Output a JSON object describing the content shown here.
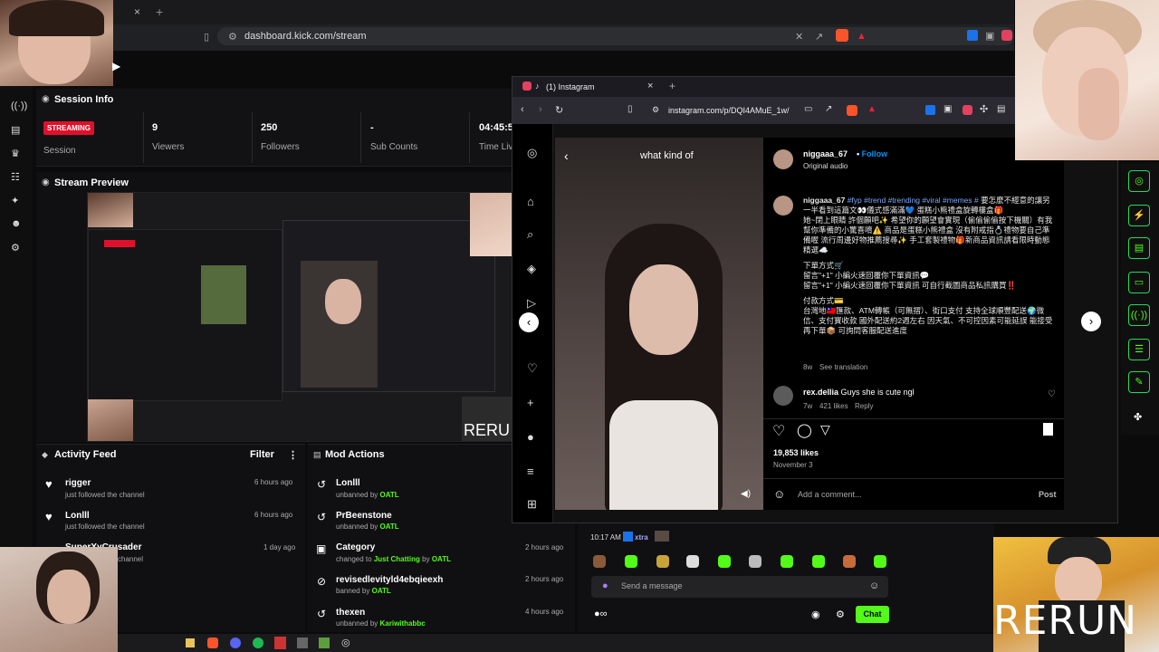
{
  "browser": {
    "url": "dashboard.kick.com/stream",
    "tab_close": "×",
    "tab_new": "+"
  },
  "session": {
    "title": "Session Info",
    "badge": "STREAMING",
    "session_label": "Session",
    "viewers_value": "9",
    "viewers_label": "Viewers",
    "followers_value": "250",
    "followers_label": "Followers",
    "subs_value": "-",
    "subs_label": "Sub Counts",
    "time_value": "04:45:5",
    "time_label": "Time Liv"
  },
  "preview": {
    "title": "Stream Preview",
    "rerun": "RERU"
  },
  "activity": {
    "title": "Activity Feed",
    "filter": "Filter",
    "more": "⋮",
    "items": [
      {
        "name": "rigger",
        "sub": "just followed the channel",
        "time": "6 hours ago"
      },
      {
        "name": "Lonlll",
        "sub": "just followed the channel",
        "time": "6 hours ago"
      },
      {
        "name": "SuperXyCrusader",
        "sub": "channel",
        "time": "1 day ago"
      }
    ]
  },
  "mod": {
    "title": "Mod Actions",
    "items": [
      {
        "name": "Lonlll",
        "pre": "unbanned by ",
        "by": "OATL",
        "mid": "",
        "extra": "",
        "time": ""
      },
      {
        "name": "PrBeenstone",
        "pre": "unbanned by ",
        "by": "OATL",
        "mid": "",
        "extra": "",
        "time": ""
      },
      {
        "name": "Category",
        "pre": "changed to ",
        "by": "Just Chatting",
        "mid": " by ",
        "extra": "OATL",
        "time": "2 hours ago"
      },
      {
        "name": "revisedlevityld4ebqieexh",
        "pre": "banned by ",
        "by": "OATL",
        "mid": "",
        "extra": "",
        "time": "2 hours ago"
      },
      {
        "name": "thexen",
        "pre": "unbanned by ",
        "by": "Kariwithabbc",
        "mid": "",
        "extra": "",
        "time": "4 hours ago"
      }
    ]
  },
  "instagram": {
    "tab_title": "(1) Instagram",
    "tab_close": "×",
    "tab_new": "+",
    "url": "instagram.com/p/DQI4AMuE_1w/",
    "video_caption": "what kind of",
    "author": "niggaaa_67",
    "follow": "Follow",
    "audio": "Original audio",
    "caption_author": "niggaaa_67",
    "caption_tags": "#fyp #trend #trending #viral #memes #",
    "caption_lines": [
      "要怎麼不經意的讓另一半看到這篇文👀儀式感滿滿💙 蛋糕小熊禮盒旋轉樓盒🎁",
      "她~閉上眼睛 許個願吧✨ 希望你的願望會實現（偷偷偷偷按下機關）有我幫你準備的小驚喜唷⚠️ 商品是蛋糕小熊禮盒 沒有附戒指💍禮物要自己準備喔 流行周邊好物推薦搜尋✨ 手工套製禮物🎁新商品資訊請看限時動態精選☁️",
      "",
      "下單方式🛒",
      "留言\"+1\" 小編火速回覆你下單資訊💬",
      "留言\"+1\" 小編火速回覆你下單資訊 可自行截圖商品私訊購買‼️",
      "",
      "付款方式💳",
      "台灣地🇹🇼匯款、ATM轉帳（可無摺）、街口支付 支持全球順豐配送🌍微信、支付寶收款 國外配送約2週左右 因天氣、不可控因素可能延誤 能接受再下單📦 可詢問客服配送進度"
    ],
    "caption_age": "8w",
    "see_translation": "See translation",
    "comment_user": "rex.dellia",
    "comment_text": "Guys she is cute ngl",
    "comment_age": "7w",
    "comment_likes": "421 likes",
    "comment_reply": "Reply",
    "likes": "19,853 likes",
    "date": "November 3",
    "add_comment": "Add a comment...",
    "post": "Post"
  },
  "chat": {
    "time": "10:17 AM",
    "user": "xtra",
    "placeholder": "Send a message",
    "button": "Chat"
  },
  "overlay": {
    "rerun": "RERUN"
  }
}
